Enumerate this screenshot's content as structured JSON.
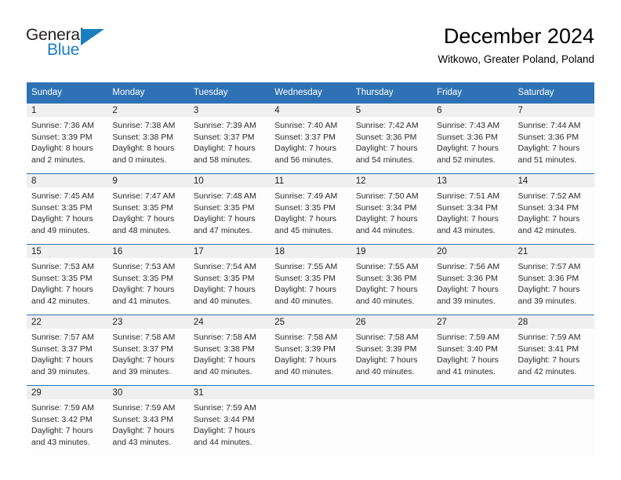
{
  "brand": {
    "name_top": "General",
    "name_bottom": "Blue",
    "triangle_icon": "triangle-icon",
    "color_dark": "#231f20",
    "color_blue": "#1a7fc1"
  },
  "header": {
    "title": "December 2024",
    "subtitle": "Witkowo, Greater Poland, Poland"
  },
  "theme": {
    "header_blue": "#2e72b5",
    "daynum_band": "#efefef",
    "cell_bg": "#fdfdfd"
  },
  "calendar": {
    "weekdays": [
      "Sunday",
      "Monday",
      "Tuesday",
      "Wednesday",
      "Thursday",
      "Friday",
      "Saturday"
    ],
    "weeks": [
      [
        {
          "day": "1",
          "sunrise": "Sunrise: 7:36 AM",
          "sunset": "Sunset: 3:39 PM",
          "daylight_1": "Daylight: 8 hours",
          "daylight_2": "and 2 minutes."
        },
        {
          "day": "2",
          "sunrise": "Sunrise: 7:38 AM",
          "sunset": "Sunset: 3:38 PM",
          "daylight_1": "Daylight: 8 hours",
          "daylight_2": "and 0 minutes."
        },
        {
          "day": "3",
          "sunrise": "Sunrise: 7:39 AM",
          "sunset": "Sunset: 3:37 PM",
          "daylight_1": "Daylight: 7 hours",
          "daylight_2": "and 58 minutes."
        },
        {
          "day": "4",
          "sunrise": "Sunrise: 7:40 AM",
          "sunset": "Sunset: 3:37 PM",
          "daylight_1": "Daylight: 7 hours",
          "daylight_2": "and 56 minutes."
        },
        {
          "day": "5",
          "sunrise": "Sunrise: 7:42 AM",
          "sunset": "Sunset: 3:36 PM",
          "daylight_1": "Daylight: 7 hours",
          "daylight_2": "and 54 minutes."
        },
        {
          "day": "6",
          "sunrise": "Sunrise: 7:43 AM",
          "sunset": "Sunset: 3:36 PM",
          "daylight_1": "Daylight: 7 hours",
          "daylight_2": "and 52 minutes."
        },
        {
          "day": "7",
          "sunrise": "Sunrise: 7:44 AM",
          "sunset": "Sunset: 3:36 PM",
          "daylight_1": "Daylight: 7 hours",
          "daylight_2": "and 51 minutes."
        }
      ],
      [
        {
          "day": "8",
          "sunrise": "Sunrise: 7:45 AM",
          "sunset": "Sunset: 3:35 PM",
          "daylight_1": "Daylight: 7 hours",
          "daylight_2": "and 49 minutes."
        },
        {
          "day": "9",
          "sunrise": "Sunrise: 7:47 AM",
          "sunset": "Sunset: 3:35 PM",
          "daylight_1": "Daylight: 7 hours",
          "daylight_2": "and 48 minutes."
        },
        {
          "day": "10",
          "sunrise": "Sunrise: 7:48 AM",
          "sunset": "Sunset: 3:35 PM",
          "daylight_1": "Daylight: 7 hours",
          "daylight_2": "and 47 minutes."
        },
        {
          "day": "11",
          "sunrise": "Sunrise: 7:49 AM",
          "sunset": "Sunset: 3:35 PM",
          "daylight_1": "Daylight: 7 hours",
          "daylight_2": "and 45 minutes."
        },
        {
          "day": "12",
          "sunrise": "Sunrise: 7:50 AM",
          "sunset": "Sunset: 3:34 PM",
          "daylight_1": "Daylight: 7 hours",
          "daylight_2": "and 44 minutes."
        },
        {
          "day": "13",
          "sunrise": "Sunrise: 7:51 AM",
          "sunset": "Sunset: 3:34 PM",
          "daylight_1": "Daylight: 7 hours",
          "daylight_2": "and 43 minutes."
        },
        {
          "day": "14",
          "sunrise": "Sunrise: 7:52 AM",
          "sunset": "Sunset: 3:34 PM",
          "daylight_1": "Daylight: 7 hours",
          "daylight_2": "and 42 minutes."
        }
      ],
      [
        {
          "day": "15",
          "sunrise": "Sunrise: 7:53 AM",
          "sunset": "Sunset: 3:35 PM",
          "daylight_1": "Daylight: 7 hours",
          "daylight_2": "and 42 minutes."
        },
        {
          "day": "16",
          "sunrise": "Sunrise: 7:53 AM",
          "sunset": "Sunset: 3:35 PM",
          "daylight_1": "Daylight: 7 hours",
          "daylight_2": "and 41 minutes."
        },
        {
          "day": "17",
          "sunrise": "Sunrise: 7:54 AM",
          "sunset": "Sunset: 3:35 PM",
          "daylight_1": "Daylight: 7 hours",
          "daylight_2": "and 40 minutes."
        },
        {
          "day": "18",
          "sunrise": "Sunrise: 7:55 AM",
          "sunset": "Sunset: 3:35 PM",
          "daylight_1": "Daylight: 7 hours",
          "daylight_2": "and 40 minutes."
        },
        {
          "day": "19",
          "sunrise": "Sunrise: 7:55 AM",
          "sunset": "Sunset: 3:36 PM",
          "daylight_1": "Daylight: 7 hours",
          "daylight_2": "and 40 minutes."
        },
        {
          "day": "20",
          "sunrise": "Sunrise: 7:56 AM",
          "sunset": "Sunset: 3:36 PM",
          "daylight_1": "Daylight: 7 hours",
          "daylight_2": "and 39 minutes."
        },
        {
          "day": "21",
          "sunrise": "Sunrise: 7:57 AM",
          "sunset": "Sunset: 3:36 PM",
          "daylight_1": "Daylight: 7 hours",
          "daylight_2": "and 39 minutes."
        }
      ],
      [
        {
          "day": "22",
          "sunrise": "Sunrise: 7:57 AM",
          "sunset": "Sunset: 3:37 PM",
          "daylight_1": "Daylight: 7 hours",
          "daylight_2": "and 39 minutes."
        },
        {
          "day": "23",
          "sunrise": "Sunrise: 7:58 AM",
          "sunset": "Sunset: 3:37 PM",
          "daylight_1": "Daylight: 7 hours",
          "daylight_2": "and 39 minutes."
        },
        {
          "day": "24",
          "sunrise": "Sunrise: 7:58 AM",
          "sunset": "Sunset: 3:38 PM",
          "daylight_1": "Daylight: 7 hours",
          "daylight_2": "and 40 minutes."
        },
        {
          "day": "25",
          "sunrise": "Sunrise: 7:58 AM",
          "sunset": "Sunset: 3:39 PM",
          "daylight_1": "Daylight: 7 hours",
          "daylight_2": "and 40 minutes."
        },
        {
          "day": "26",
          "sunrise": "Sunrise: 7:58 AM",
          "sunset": "Sunset: 3:39 PM",
          "daylight_1": "Daylight: 7 hours",
          "daylight_2": "and 40 minutes."
        },
        {
          "day": "27",
          "sunrise": "Sunrise: 7:59 AM",
          "sunset": "Sunset: 3:40 PM",
          "daylight_1": "Daylight: 7 hours",
          "daylight_2": "and 41 minutes."
        },
        {
          "day": "28",
          "sunrise": "Sunrise: 7:59 AM",
          "sunset": "Sunset: 3:41 PM",
          "daylight_1": "Daylight: 7 hours",
          "daylight_2": "and 42 minutes."
        }
      ],
      [
        {
          "day": "29",
          "sunrise": "Sunrise: 7:59 AM",
          "sunset": "Sunset: 3:42 PM",
          "daylight_1": "Daylight: 7 hours",
          "daylight_2": "and 43 minutes."
        },
        {
          "day": "30",
          "sunrise": "Sunrise: 7:59 AM",
          "sunset": "Sunset: 3:43 PM",
          "daylight_1": "Daylight: 7 hours",
          "daylight_2": "and 43 minutes."
        },
        {
          "day": "31",
          "sunrise": "Sunrise: 7:59 AM",
          "sunset": "Sunset: 3:44 PM",
          "daylight_1": "Daylight: 7 hours",
          "daylight_2": "and 44 minutes."
        },
        {
          "day": "",
          "sunrise": "",
          "sunset": "",
          "daylight_1": "",
          "daylight_2": ""
        },
        {
          "day": "",
          "sunrise": "",
          "sunset": "",
          "daylight_1": "",
          "daylight_2": ""
        },
        {
          "day": "",
          "sunrise": "",
          "sunset": "",
          "daylight_1": "",
          "daylight_2": ""
        },
        {
          "day": "",
          "sunrise": "",
          "sunset": "",
          "daylight_1": "",
          "daylight_2": ""
        }
      ]
    ]
  }
}
